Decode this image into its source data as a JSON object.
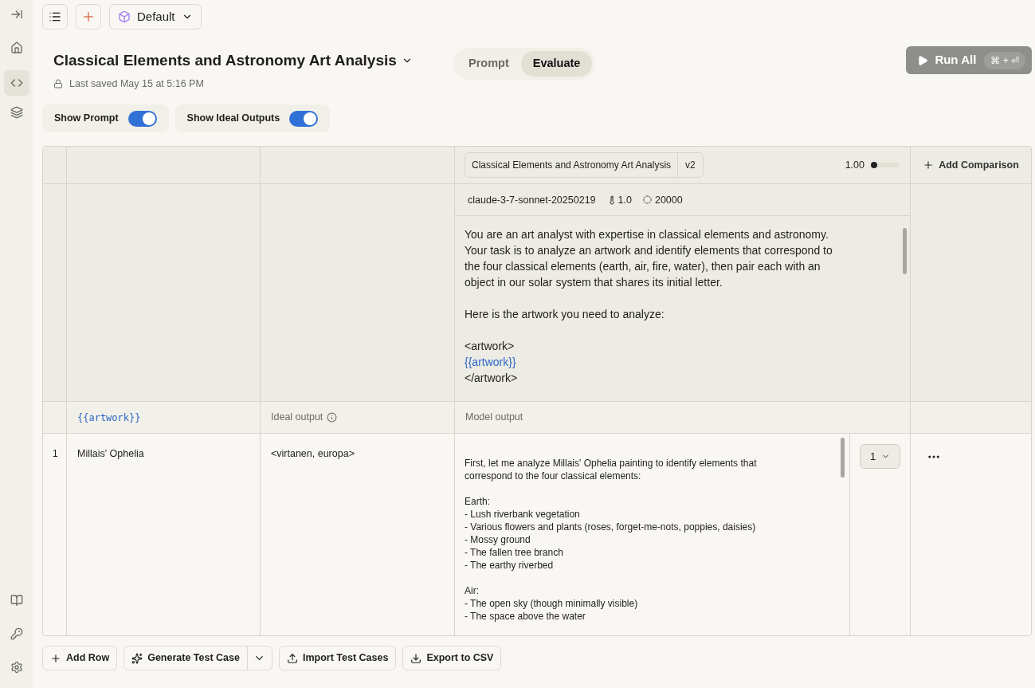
{
  "toolbar": {
    "preset": "Default"
  },
  "header": {
    "title": "Classical Elements and Astronomy Art Analysis",
    "saved": "Last saved May 15 at 5:16 PM"
  },
  "mode_tabs": [
    {
      "label": "Prompt",
      "selected": false
    },
    {
      "label": "Evaluate",
      "selected": true
    }
  ],
  "run_button": {
    "label": "Run All",
    "shortcut": "⌘ + ⏎"
  },
  "toggles": [
    {
      "label": "Show Prompt",
      "on": true
    },
    {
      "label": "Show Ideal Outputs",
      "on": true
    }
  ],
  "prompt_column": {
    "name": "Classical Elements and Astronomy Art Analysis",
    "version": "v2",
    "score": "1.00",
    "level": 0,
    "model": "claude-3-7-sonnet-20250219",
    "temperature": "1.0",
    "max_tokens": "20000"
  },
  "add_comparison": "Add Comparison",
  "prompt_lines": [
    {
      "kind": "text",
      "text": "You are an art analyst with expertise in classical elements and astronomy."
    },
    {
      "kind": "text",
      "text": "Your task is to analyze an artwork and identify elements that correspond to"
    },
    {
      "kind": "text",
      "text": "the four classical elements (earth, air, fire, water), then pair each with an"
    },
    {
      "kind": "text",
      "text": "object in our solar system that shares its initial letter."
    },
    {
      "kind": "blank"
    },
    {
      "kind": "text",
      "text": "Here is the artwork you need to analyze:"
    },
    {
      "kind": "blank"
    },
    {
      "kind": "text",
      "text": "<artwork>"
    },
    {
      "kind": "variable",
      "text": "{{artwork}}"
    },
    {
      "kind": "text",
      "text": "</artwork>"
    }
  ],
  "table": {
    "columns": [
      {
        "label": "{{artwork}}",
        "kind": "variable"
      },
      {
        "label": "Ideal output",
        "kind": "ideal"
      },
      {
        "label": "Model output",
        "kind": "plain"
      }
    ],
    "rows": [
      {
        "number": "1",
        "input": "Millais' Ophelia",
        "ideal": "<virtanen, europa>",
        "score": "1",
        "output": [
          [
            "First, let me analyze Millais' Ophelia painting to identify elements that",
            "correspond to the four classical elements:"
          ],
          [
            "Earth:",
            "- Lush riverbank vegetation",
            "- Various flowers and plants (roses, forget-me-nots, poppies, daisies)",
            "- Mossy ground",
            "- The fallen tree branch",
            "- The earthy riverbed"
          ],
          [
            "Air:",
            "- The open sky (though minimally visible)",
            "- The space above the water"
          ]
        ]
      }
    ]
  },
  "footer_buttons": [
    {
      "label": "Add Row",
      "kind": "add"
    },
    {
      "label": "Generate Test Case",
      "kind": "generate"
    },
    {
      "label": "Import Test Cases",
      "kind": "import"
    },
    {
      "label": "Export to CSV",
      "kind": "export"
    }
  ]
}
